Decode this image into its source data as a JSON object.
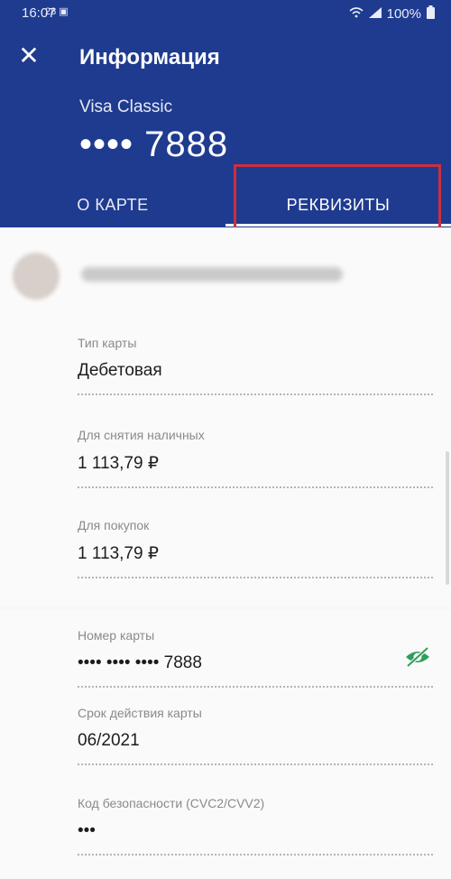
{
  "status_bar": {
    "time": "16:07",
    "icons": "28  ▣",
    "battery": "100%"
  },
  "header": {
    "title": "Информация",
    "card_name": "Visa Classic",
    "card_number": "•••• 7888"
  },
  "tabs": [
    {
      "label": "О КАРТЕ",
      "active": false
    },
    {
      "label": "РЕКВИЗИТЫ",
      "active": true
    }
  ],
  "card_info": {
    "type_label": "Тип карты",
    "type_value": "Дебетовая",
    "cash_label": "Для снятия наличных",
    "cash_value": "1 113,79 ₽",
    "purchases_label": "Для покупок",
    "purchases_value": "1 113,79 ₽"
  },
  "details": {
    "number_label": "Номер карты",
    "number_value": "•••• •••• •••• 7888",
    "expiry_label": "Срок действия карты",
    "expiry_value": "06/2021",
    "cvc_label": "Код безопасности (CVC2/CVV2)",
    "cvc_value": "•••"
  },
  "colors": {
    "header": "#1f3b8f",
    "highlight": "#cc2f3e",
    "eye_icon": "#2e9e5b"
  }
}
